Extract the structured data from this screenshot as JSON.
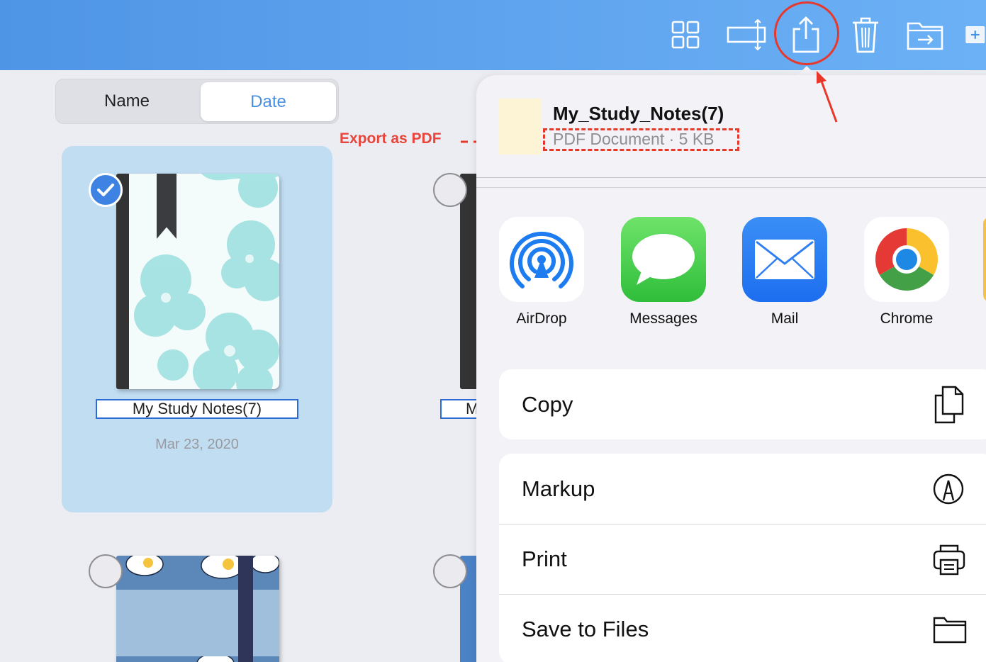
{
  "toolbar": {
    "buttons": [
      {
        "name": "grid-view",
        "icon": "grid-icon"
      },
      {
        "name": "resize",
        "icon": "resize-icon"
      },
      {
        "name": "share",
        "icon": "share-icon"
      },
      {
        "name": "delete",
        "icon": "trash-icon"
      },
      {
        "name": "move",
        "icon": "folder-move-icon"
      },
      {
        "name": "add",
        "icon": "plus-icon"
      }
    ]
  },
  "sort": {
    "options": [
      "Name",
      "Date"
    ],
    "selected": "Date"
  },
  "annotation": {
    "export_label": "Export as PDF",
    "color": "#e8382c"
  },
  "notebooks": [
    {
      "title": "My Study Notes(7)",
      "date": "Mar 23, 2020",
      "selected": true
    },
    {
      "title": "M",
      "date": "",
      "selected": false
    }
  ],
  "share_sheet": {
    "file": {
      "name": "My_Study_Notes(7)",
      "meta": "PDF Document · 5 KB"
    },
    "apps": [
      {
        "label": "AirDrop",
        "icon": "airdrop-icon"
      },
      {
        "label": "Messages",
        "icon": "messages-icon"
      },
      {
        "label": "Mail",
        "icon": "mail-icon"
      },
      {
        "label": "Chrome",
        "icon": "chrome-icon"
      }
    ],
    "actions": [
      {
        "label": "Copy",
        "icon": "copy-icon"
      },
      {
        "label": "Markup",
        "icon": "markup-icon"
      },
      {
        "label": "Print",
        "icon": "print-icon"
      },
      {
        "label": "Save to Files",
        "icon": "folder-icon"
      }
    ]
  },
  "colors": {
    "toolbar_start": "#4f95e6",
    "toolbar_end": "#6cb1f5",
    "accent": "#4a90e2",
    "selected_card": "#c1ddf2"
  }
}
